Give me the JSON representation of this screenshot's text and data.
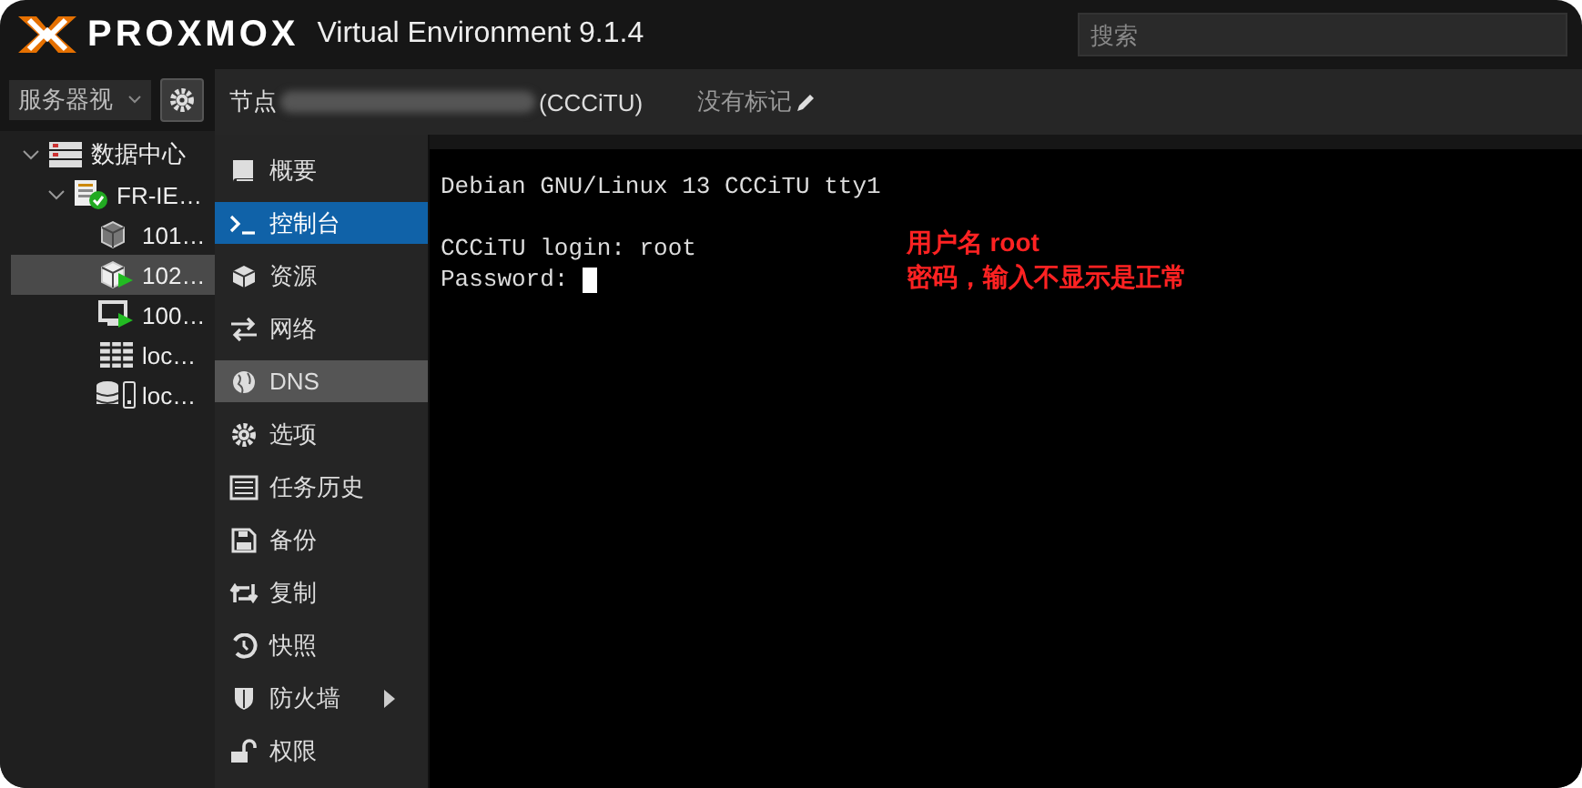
{
  "header": {
    "logo": "PROXMOX",
    "product": "Virtual Environment 9.1.4",
    "search": {
      "placeholder": "搜索"
    }
  },
  "sidebar": {
    "view_select": "服务器视",
    "tree": [
      {
        "label": "数据中心",
        "kind": "datacenter",
        "selected": false,
        "expanded": true,
        "children": [
          {
            "label": "FR-IE…",
            "kind": "node",
            "selected": false,
            "expanded": true,
            "children": [
              {
                "label": "101…",
                "kind": "container",
                "selected": false,
                "running": false
              },
              {
                "label": "102…",
                "kind": "container",
                "selected": true,
                "running": true
              },
              {
                "label": "100…",
                "kind": "vm",
                "selected": false,
                "running": true
              },
              {
                "label": "loc…",
                "kind": "storage",
                "selected": false
              },
              {
                "label": "loc…",
                "kind": "disk",
                "selected": false
              }
            ]
          }
        ]
      }
    ]
  },
  "node_bar": {
    "prefix": "节点",
    "name_suffix": "(CCCiTU)",
    "tags": "没有标记"
  },
  "menu": [
    {
      "label": "概要",
      "kind": "book",
      "selected": false,
      "hovered": false,
      "submenu": false
    },
    {
      "label": "控制台",
      "kind": "terminal",
      "selected": true,
      "hovered": false,
      "submenu": false
    },
    {
      "label": "资源",
      "kind": "cube",
      "selected": false,
      "hovered": false,
      "submenu": false
    },
    {
      "label": "网络",
      "kind": "exchange",
      "selected": false,
      "hovered": false,
      "submenu": false
    },
    {
      "label": "DNS",
      "kind": "globe",
      "selected": false,
      "hovered": true,
      "submenu": false
    },
    {
      "label": "选项",
      "kind": "gear",
      "selected": false,
      "hovered": false,
      "submenu": false
    },
    {
      "label": "任务历史",
      "kind": "list",
      "selected": false,
      "hovered": false,
      "submenu": false
    },
    {
      "label": "备份",
      "kind": "floppy",
      "selected": false,
      "hovered": false,
      "submenu": false
    },
    {
      "label": "复制",
      "kind": "retweet",
      "selected": false,
      "hovered": false,
      "submenu": false
    },
    {
      "label": "快照",
      "kind": "history",
      "selected": false,
      "hovered": false,
      "submenu": false
    },
    {
      "label": "防火墙",
      "kind": "shield",
      "selected": false,
      "hovered": false,
      "submenu": true
    },
    {
      "label": "权限",
      "kind": "unlock",
      "selected": false,
      "hovered": false,
      "submenu": false
    }
  ],
  "console": {
    "lines": [
      "Debian GNU/Linux 13 CCCiTU tty1",
      "CCCiTU login: root",
      "Password: "
    ],
    "annotations": [
      "用户名 root",
      "密码，输入不显示是正常"
    ]
  }
}
